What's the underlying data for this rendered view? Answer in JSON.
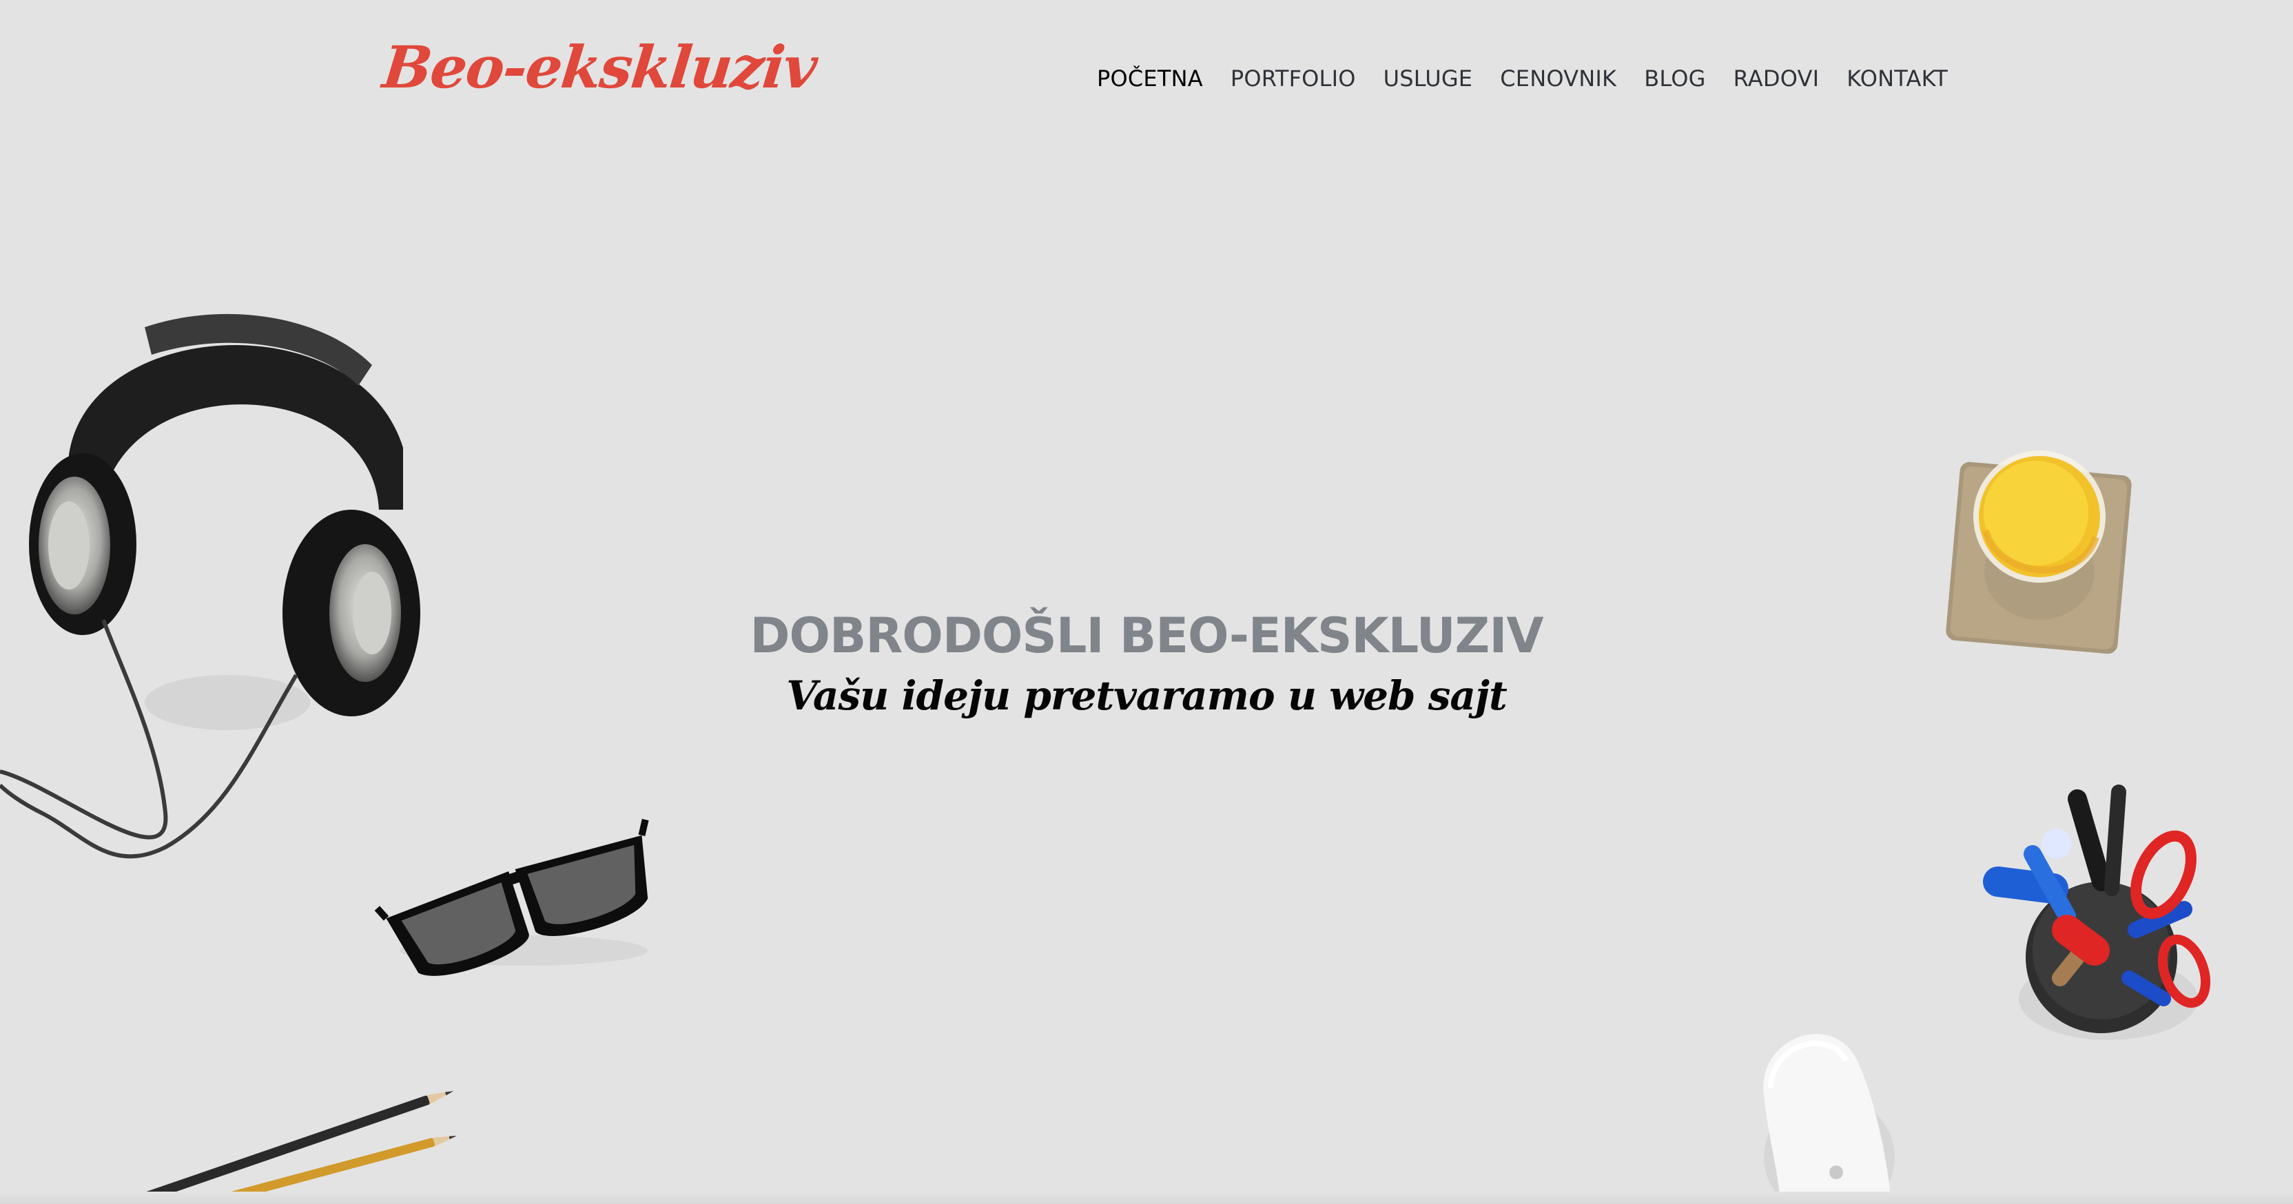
{
  "site": {
    "logo": "Beo-ekskluziv"
  },
  "nav": {
    "items": [
      {
        "label": "POČETNA",
        "active": true
      },
      {
        "label": "PORTFOLIO",
        "active": false
      },
      {
        "label": "USLUGE",
        "active": false
      },
      {
        "label": "CENOVNIK",
        "active": false
      },
      {
        "label": "BLOG",
        "active": false
      },
      {
        "label": "RADOVI",
        "active": false
      },
      {
        "label": "KONTAKT",
        "active": false
      }
    ]
  },
  "hero": {
    "title": "DOBRODOŠLI BEO-EKSKLUZIV",
    "subtitle": "Vašu ideju pretvaramo u web sajt"
  },
  "decor": {
    "icons": [
      "headphones-icon",
      "glasses-icon",
      "pencils-icon",
      "juice-glass-icon",
      "pen-cup-icon",
      "mouse-icon"
    ]
  },
  "colors": {
    "background": "#e3e3e3",
    "logo": "#e0483b",
    "nav_text": "#2f3237",
    "hero_title": "#80848b",
    "hero_subtitle": "#050505"
  }
}
